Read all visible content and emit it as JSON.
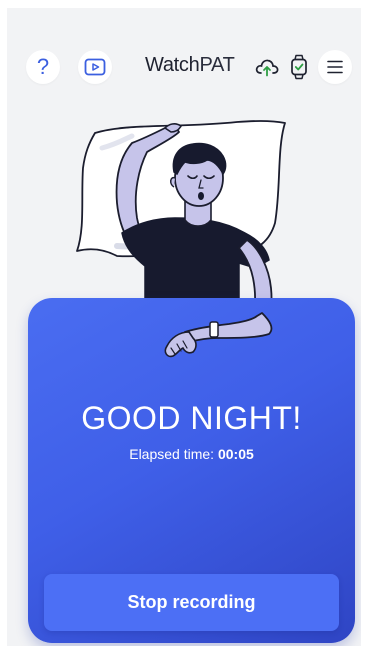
{
  "header": {
    "help_label": "?",
    "brand_bold": "Watch",
    "brand_light": "PAT"
  },
  "icons": {
    "help": "question-icon",
    "video": "play-video-icon",
    "cloud": "cloud-upload-icon",
    "watch": "watch-check-icon",
    "menu": "hamburger-menu-icon"
  },
  "main": {
    "title": "GOOD NIGHT!",
    "elapsed_label": "Elapsed time: ",
    "elapsed_value": "00:05",
    "stop_button": "Stop recording"
  },
  "colors": {
    "accent": "#3f5fe8",
    "button": "#4c6ff5",
    "screen_bg": "#f2f3f5",
    "cloud_arrow": "#2e9e44"
  }
}
